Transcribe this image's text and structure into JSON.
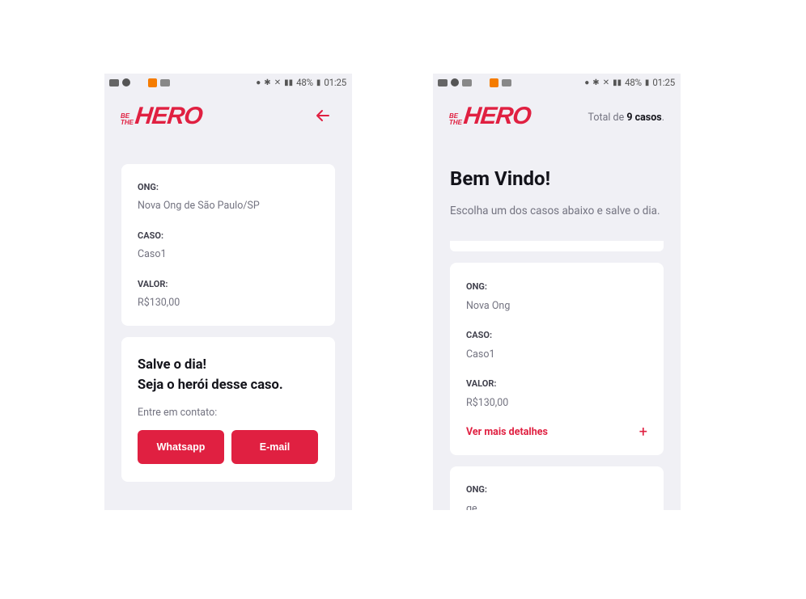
{
  "status_bar": {
    "left": {
      "battery": "48%",
      "time": "01:25"
    },
    "right": {
      "battery": "48%",
      "time": "01:25"
    }
  },
  "logo": {
    "small_top": "BE",
    "small_bottom": "THE",
    "big": "HERO"
  },
  "detail_screen": {
    "incident": {
      "ong_label": "ONG:",
      "ong_value": "Nova Ong de São Paulo/SP",
      "case_label": "CASO:",
      "case_value": "Caso1",
      "value_label": "VALOR:",
      "value_value": "R$130,00"
    },
    "contact": {
      "title_line1": "Salve o dia!",
      "title_line2": "Seja o herói desse caso.",
      "subtitle": "Entre em contato:",
      "whatsapp_label": "Whatsapp",
      "email_label": "E-mail"
    }
  },
  "list_screen": {
    "total_prefix": "Total de ",
    "total_count": "9 casos",
    "total_suffix": ".",
    "title": "Bem Vindo!",
    "subtitle": "Escolha um dos casos abaixo e salve o dia.",
    "incidents": [
      {
        "ong_label": "ONG:",
        "ong_value": "Nova Ong",
        "case_label": "CASO:",
        "case_value": "Caso1",
        "value_label": "VALOR:",
        "value_value": "R$130,00",
        "details_label": "Ver mais detalhes",
        "details_icon": "+"
      },
      {
        "ong_label": "ONG:",
        "ong_value": "ge"
      }
    ]
  },
  "colors": {
    "accent": "#e02041",
    "background": "#f0f0f5",
    "card": "#ffffff",
    "title": "#13131a",
    "text": "#737380",
    "label": "#41414d"
  },
  "icons": [
    "back-arrow-icon",
    "plus-icon",
    "notification-icon",
    "bluetooth-icon",
    "wifi-icon",
    "signal-icon",
    "battery-icon",
    "location-icon",
    "mute-icon"
  ]
}
